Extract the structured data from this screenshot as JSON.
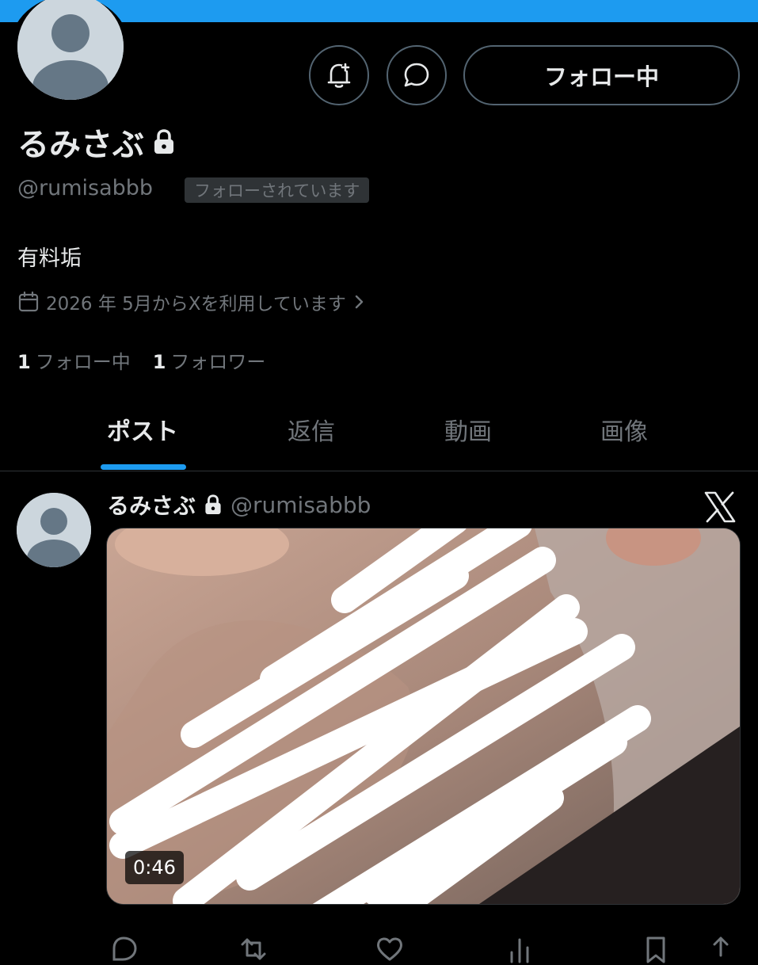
{
  "profile": {
    "display_name": "るみさぶ",
    "handle": "@rumisabbb",
    "follows_you_badge": "フォローされています",
    "bio": "有料垢",
    "joined": "2026 年 5月からXを利用しています",
    "following_count": "1",
    "following_label": "フォロー中",
    "followers_count": "1",
    "followers_label": "フォロワー",
    "locked_icon": "lock-icon"
  },
  "header_actions": {
    "notify_icon": "bell-plus-icon",
    "message_icon": "message-icon",
    "follow_button_label": "フォロー中"
  },
  "tabs": [
    {
      "label": "ポスト",
      "active": true
    },
    {
      "label": "返信",
      "active": false
    },
    {
      "label": "動画",
      "active": false
    },
    {
      "label": "画像",
      "active": false
    }
  ],
  "post": {
    "display_name": "るみさぶ",
    "handle": "@rumisabbb",
    "video_duration": "0:46",
    "source_icon": "x-logo-icon",
    "actions": [
      "reply-icon",
      "repost-icon",
      "like-icon",
      "views-icon",
      "bookmark-icon",
      "share-icon"
    ]
  },
  "colors": {
    "accent": "#1d9bf0",
    "background": "#000000",
    "text_primary": "#e7e9ea",
    "text_secondary": "#71767b",
    "border": "#536471"
  }
}
